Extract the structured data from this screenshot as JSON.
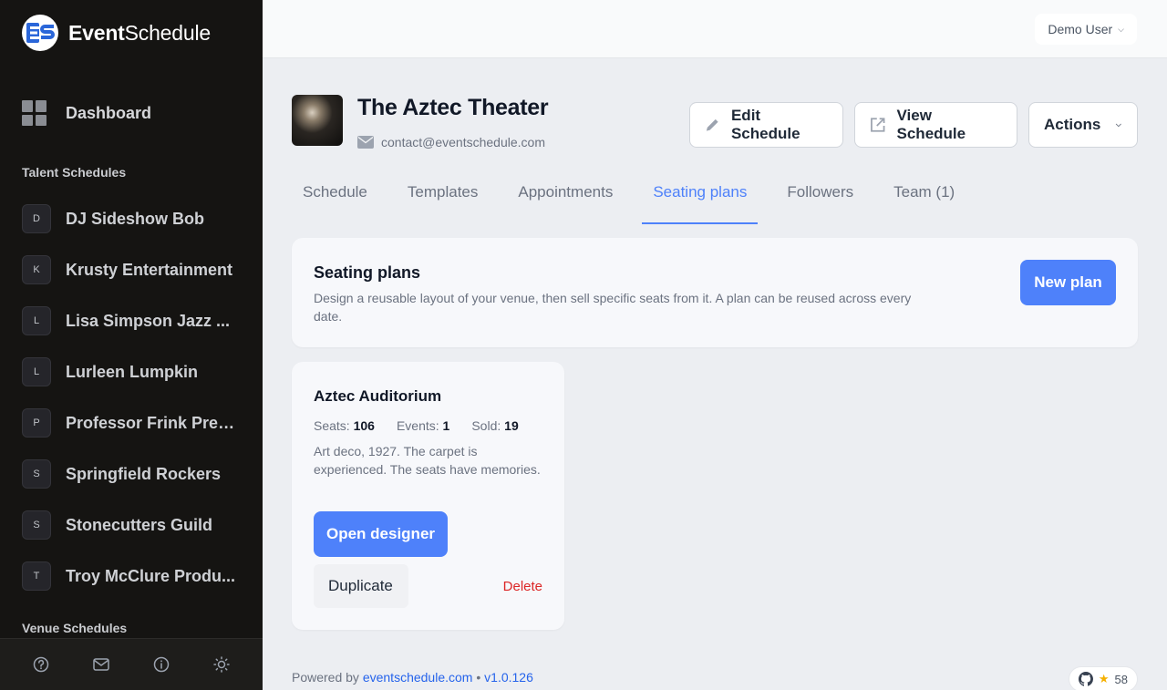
{
  "app": {
    "brand_bold": "Event",
    "brand_regular": "Schedule"
  },
  "sidebar": {
    "dashboard_label": "Dashboard",
    "talent_title": "Talent Schedules",
    "talent_items": [
      {
        "initial": "D",
        "name": "DJ Sideshow Bob"
      },
      {
        "initial": "K",
        "name": "Krusty Entertainment"
      },
      {
        "initial": "L",
        "name": "Lisa Simpson Jazz ..."
      },
      {
        "initial": "L",
        "name": "Lurleen Lumpkin"
      },
      {
        "initial": "P",
        "name": "Professor Frink Pres..."
      },
      {
        "initial": "S",
        "name": "Springfield Rockers"
      },
      {
        "initial": "S",
        "name": "Stonecutters Guild"
      },
      {
        "initial": "T",
        "name": "Troy McClure Produ..."
      }
    ],
    "venue_title": "Venue Schedules",
    "footer_icons": [
      "help-icon",
      "mail-icon",
      "info-icon",
      "sun-icon"
    ]
  },
  "topbar": {
    "user_name": "Demo User"
  },
  "venue": {
    "name": "The Aztec Theater",
    "email": "contact@eventschedule.com"
  },
  "header_buttons": {
    "edit": "Edit Schedule",
    "view": "View Schedule",
    "actions": "Actions"
  },
  "tabs": [
    {
      "label": "Schedule",
      "active": false
    },
    {
      "label": "Templates",
      "active": false
    },
    {
      "label": "Appointments",
      "active": false
    },
    {
      "label": "Seating plans",
      "active": true
    },
    {
      "label": "Followers",
      "active": false
    },
    {
      "label": "Team (1)",
      "active": false
    }
  ],
  "panel": {
    "title": "Seating plans",
    "description": "Design a reusable layout of your venue, then sell specific seats from it. A plan can be reused across every date.",
    "new_plan": "New plan"
  },
  "plan": {
    "name": "Aztec Auditorium",
    "seats_label": "Seats:",
    "seats": "106",
    "events_label": "Events:",
    "events": "1",
    "sold_label": "Sold:",
    "sold": "19",
    "description": "Art deco, 1927. The carpet is experienced. The seats have memories.",
    "open_designer": "Open designer",
    "duplicate": "Duplicate",
    "delete": "Delete"
  },
  "footer": {
    "powered_by": "Powered by",
    "site": "eventschedule.com",
    "separator": "•",
    "version": "v1.0.126",
    "github_stars": "58"
  },
  "colors": {
    "accent": "#4e81fa",
    "sidebar_bg": "#151412",
    "danger": "#dc2626"
  }
}
